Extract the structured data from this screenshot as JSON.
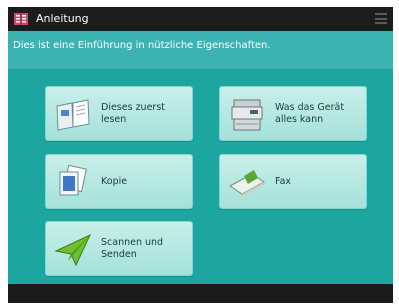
{
  "header": {
    "title": "Anleitung",
    "app_icon": "guide-book-icon",
    "menu_icon": "hamburger-menu-icon"
  },
  "banner": {
    "text": "Dies ist eine Einführung in nützliche Eigenschaften."
  },
  "buttons": [
    {
      "label": "Dieses zuerst lesen",
      "icon": "open-book-icon"
    },
    {
      "label": "Was das Gerät alles kann",
      "icon": "printer-device-icon"
    },
    {
      "label": "Kopie",
      "icon": "copy-documents-icon"
    },
    {
      "label": "Fax",
      "icon": "fax-paper-icon"
    },
    {
      "label": "Scannen und Senden",
      "icon": "send-plane-icon"
    }
  ],
  "colors": {
    "accent": "#1da59f",
    "banner": "#3cb3b1",
    "titlebar": "#1c1c1c",
    "button": "#b8e8e2"
  }
}
